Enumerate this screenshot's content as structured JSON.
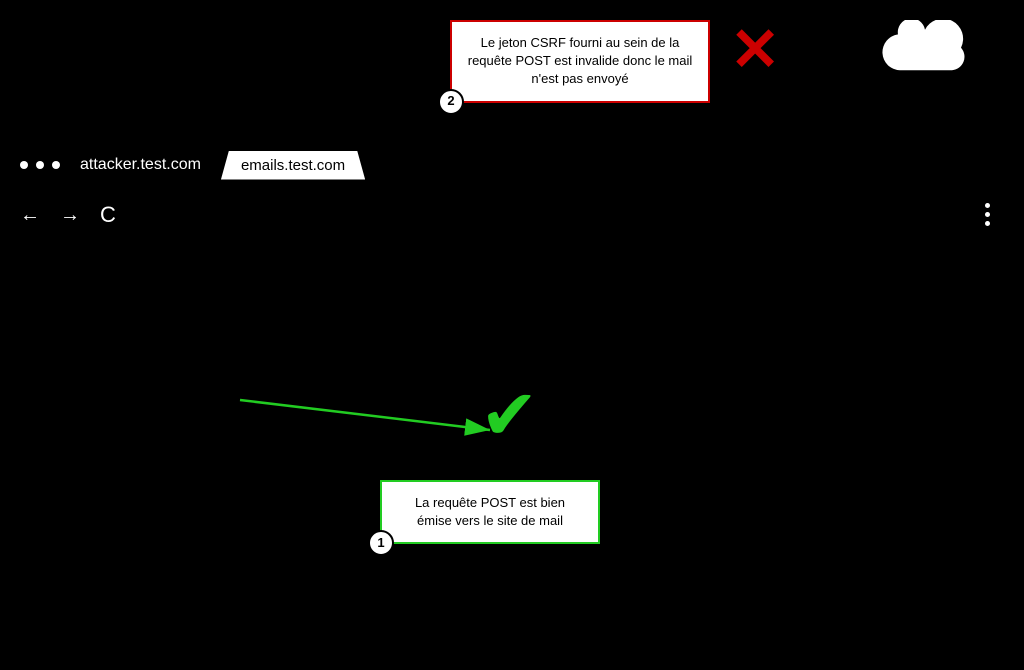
{
  "browser": {
    "attacker_url": "attacker.test.com",
    "emails_tab": "emails.test.com",
    "dots_count": 3
  },
  "nav": {
    "back_arrow": "←",
    "forward_arrow": "→",
    "refresh": "C"
  },
  "csrf_box": {
    "text": "Le jeton CSRF fourni au sein de la requête POST est invalide donc le mail n'est pas envoyé",
    "step": "2"
  },
  "post_box": {
    "text": "La requête POST est bien émise vers le site de mail",
    "step": "1"
  },
  "icons": {
    "red_x": "✕",
    "green_check": "✔"
  },
  "colors": {
    "csrf_border": "#cc0000",
    "post_border": "#22cc22",
    "green_check": "#22cc22",
    "red_x": "#cc0000",
    "background": "#000000",
    "text_light": "#ffffff"
  }
}
